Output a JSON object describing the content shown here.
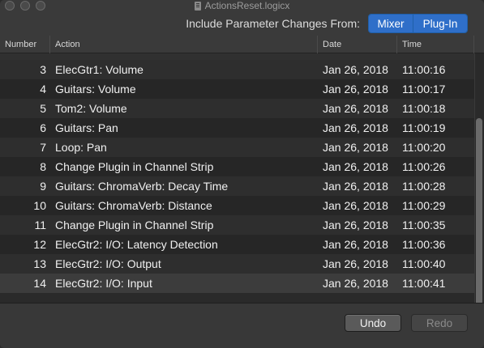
{
  "window": {
    "title": "ActionsReset.logicx"
  },
  "toolbar": {
    "label": "Include Parameter Changes From:",
    "segments": [
      "Mixer",
      "Plug-In"
    ]
  },
  "table": {
    "columns": [
      "Number",
      "Action",
      "Date",
      "Time"
    ],
    "rows": [
      {
        "number": "3",
        "action": "ElecGtr1: Volume",
        "date": "Jan 26, 2018",
        "time": "11:00:16"
      },
      {
        "number": "4",
        "action": "Guitars: Volume",
        "date": "Jan 26, 2018",
        "time": "11:00:17"
      },
      {
        "number": "5",
        "action": "Tom2: Volume",
        "date": "Jan 26, 2018",
        "time": "11:00:18"
      },
      {
        "number": "6",
        "action": "Guitars: Pan",
        "date": "Jan 26, 2018",
        "time": "11:00:19"
      },
      {
        "number": "7",
        "action": "Loop: Pan",
        "date": "Jan 26, 2018",
        "time": "11:00:20"
      },
      {
        "number": "8",
        "action": "Change Plugin in Channel Strip",
        "date": "Jan 26, 2018",
        "time": "11:00:26"
      },
      {
        "number": "9",
        "action": "Guitars: ChromaVerb: Decay Time",
        "date": "Jan 26, 2018",
        "time": "11:00:28"
      },
      {
        "number": "10",
        "action": "Guitars: ChromaVerb: Distance",
        "date": "Jan 26, 2018",
        "time": "11:00:29"
      },
      {
        "number": "11",
        "action": "Change Plugin in Channel Strip",
        "date": "Jan 26, 2018",
        "time": "11:00:35"
      },
      {
        "number": "12",
        "action": "ElecGtr2: I/O: Latency Detection",
        "date": "Jan 26, 2018",
        "time": "11:00:36"
      },
      {
        "number": "13",
        "action": "ElecGtr2: I/O: Output",
        "date": "Jan 26, 2018",
        "time": "11:00:40"
      },
      {
        "number": "14",
        "action": "ElecGtr2: I/O: Input",
        "date": "Jan 26, 2018",
        "time": "11:00:41"
      }
    ],
    "selected_number": "14"
  },
  "footer": {
    "undo_label": "Undo",
    "redo_label": "Redo"
  },
  "colors": {
    "accent": "#2f6fc9",
    "background": "#2a2a2a"
  }
}
